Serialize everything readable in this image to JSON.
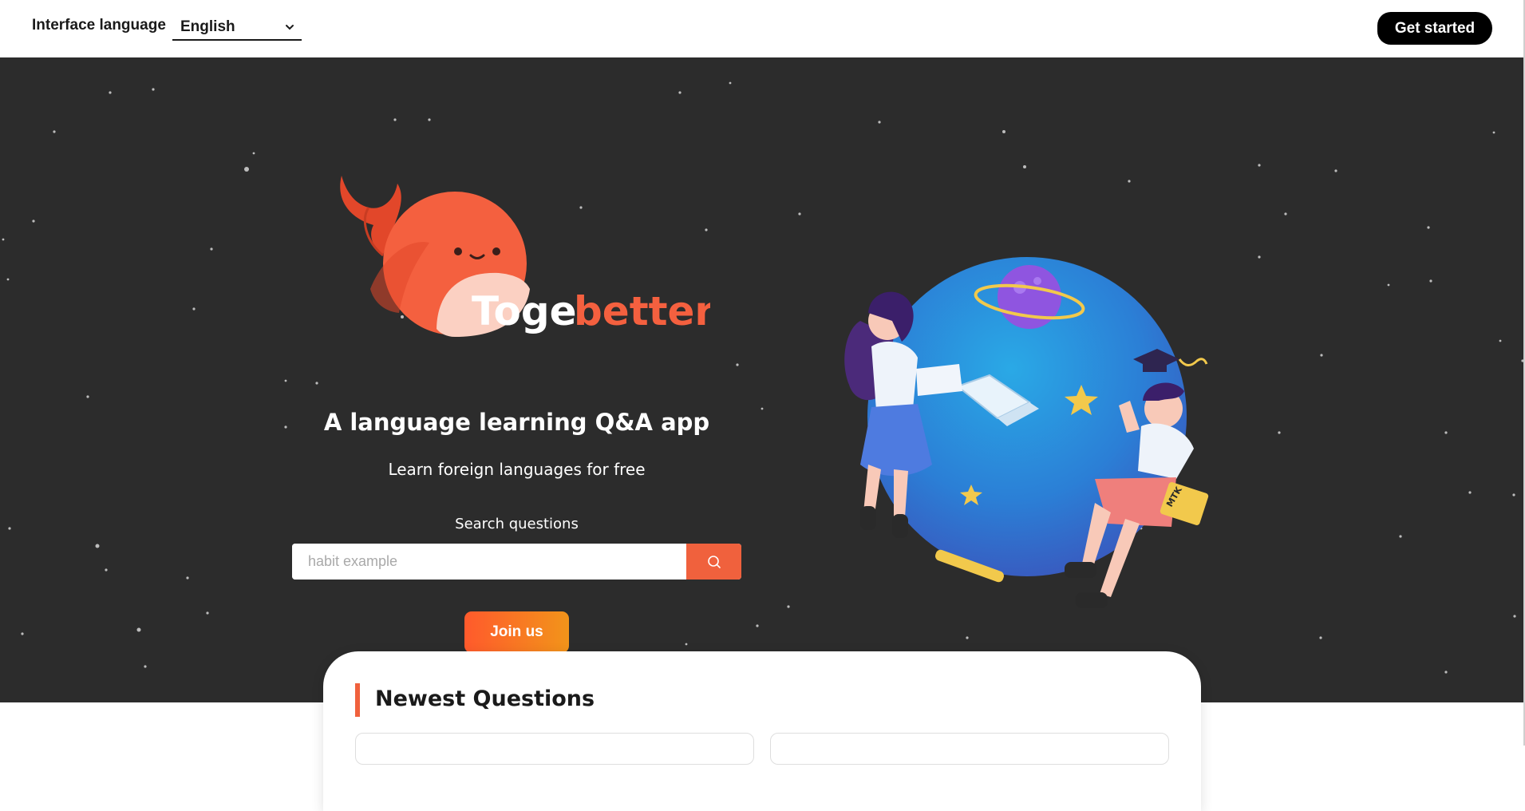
{
  "header": {
    "language_label": "Interface language",
    "language_selected": "English",
    "get_started_label": "Get started"
  },
  "hero": {
    "brand_part1": "Toge",
    "brand_part2": "better",
    "headline": "A language learning Q&A app",
    "subline": "Learn foreign languages for free",
    "search_label": "Search questions",
    "search_placeholder": "habit example",
    "join_label": "Join us",
    "illustration_badge": "MTK"
  },
  "newest": {
    "title": "Newest Questions"
  },
  "colors": {
    "accent": "#f0613d",
    "hero_bg": "#2c2c2c",
    "join_gradient_start": "#ff5a2c",
    "join_gradient_end": "#f2941a"
  },
  "icons": [
    "chevron-down-icon",
    "search-icon",
    "whale-logo-icon"
  ]
}
